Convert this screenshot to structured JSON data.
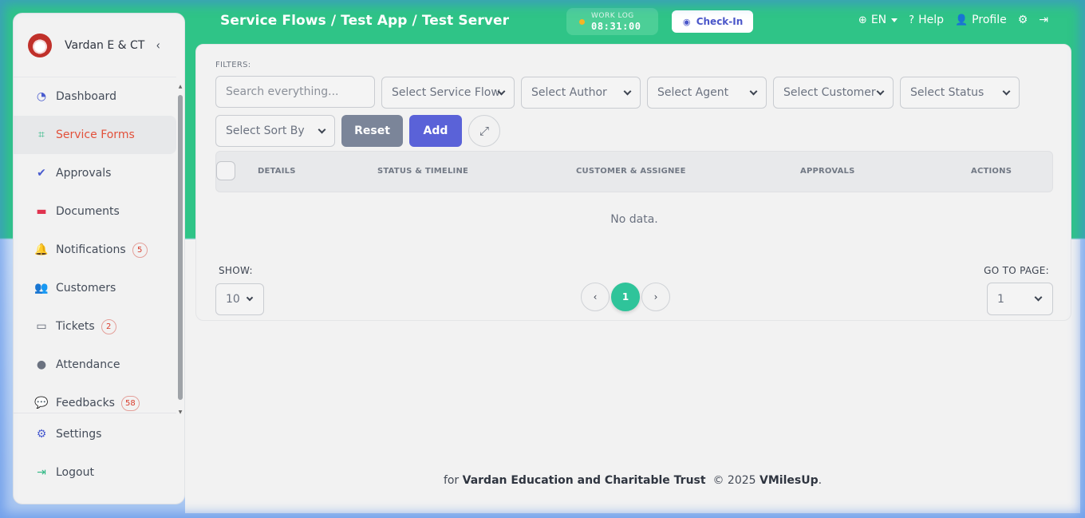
{
  "sidebar": {
    "org_name": "Vardan E & CT",
    "collapse_icon": "‹",
    "items": [
      {
        "label": "Dashboard",
        "icon": "dashboard-icon",
        "glyph": "◔",
        "color": "#4a5ccf"
      },
      {
        "label": "Service Forms",
        "icon": "sitemap-icon",
        "glyph": "⌗",
        "color": "#2fb884",
        "active": true
      },
      {
        "label": "Approvals",
        "icon": "check-circle-icon",
        "glyph": "✔",
        "color": "#4a5ccf"
      },
      {
        "label": "Documents",
        "icon": "folder-icon",
        "glyph": "▬",
        "color": "#e0334f"
      },
      {
        "label": "Notifications",
        "icon": "bell-icon",
        "glyph": "🔔",
        "color": "#2fb884",
        "badge": "5"
      },
      {
        "label": "Customers",
        "icon": "users-icon",
        "glyph": "👥",
        "color": "#2fb884"
      },
      {
        "label": "Tickets",
        "icon": "ticket-icon",
        "glyph": "▭",
        "color": "#5b6270",
        "badge": "2"
      },
      {
        "label": "Attendance",
        "icon": "user-icon",
        "glyph": "●",
        "color": "#6b7280"
      },
      {
        "label": "Feedbacks",
        "icon": "comments-icon",
        "glyph": "💬",
        "color": "#e2513b",
        "badge": "58"
      }
    ],
    "bottom": [
      {
        "label": "Settings",
        "icon": "gear-icon",
        "glyph": "⚙",
        "color": "#4a5ccf"
      },
      {
        "label": "Logout",
        "icon": "logout-icon",
        "glyph": "⇥",
        "color": "#2fb884"
      }
    ]
  },
  "header": {
    "breadcrumb": "Service Flows / Test App / Test Server",
    "worklog_label": "WORK LOG",
    "worklog_time": "08:31:00",
    "checkin_label": "Check-In",
    "language": "EN",
    "help": "Help",
    "profile": "Profile"
  },
  "filters": {
    "label": "FILTERS:",
    "search_placeholder": "Search everything...",
    "service_flow": "Select Service Flow",
    "author": "Select Author",
    "agent": "Select Agent",
    "customer": "Select Customer",
    "status": "Select Status",
    "sort_by": "Select Sort By",
    "reset": "Reset",
    "add": "Add"
  },
  "table": {
    "columns": [
      "DETAILS",
      "STATUS & TIMELINE",
      "CUSTOMER & ASSIGNEE",
      "APPROVALS",
      "ACTIONS"
    ],
    "empty_text": "No data."
  },
  "pagination": {
    "show_label": "SHOW:",
    "page_size": "10",
    "current_page": "1",
    "goto_label": "GO TO PAGE:",
    "goto_value": "1"
  },
  "footer": {
    "prefix": "for",
    "org": "Vardan Education and Charitable Trust",
    "copyright": "© 2025",
    "brand": "VMilesUp",
    "suffix": "."
  },
  "colors": {
    "header_green": "#2fc487",
    "accent_indigo": "#5a62d8",
    "active_red": "#e2513b",
    "page_teal": "#2fc49a"
  }
}
